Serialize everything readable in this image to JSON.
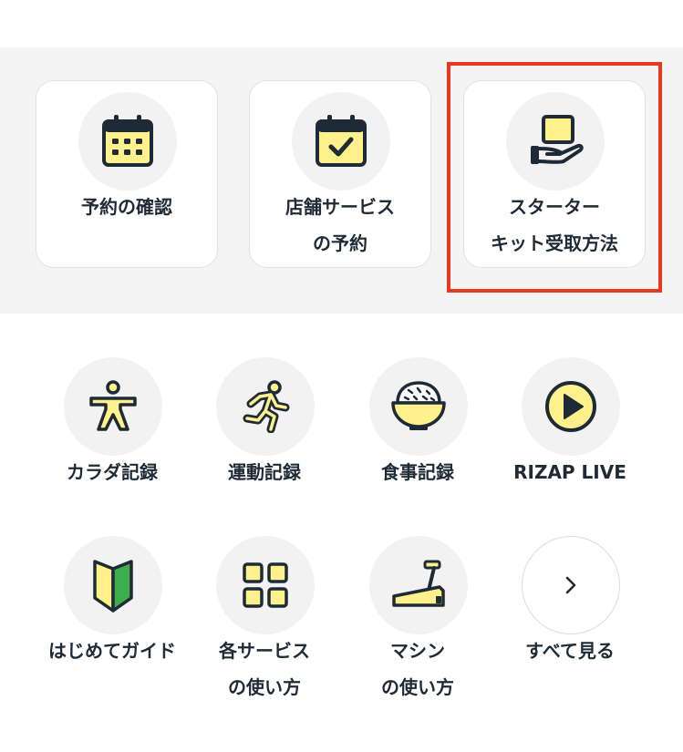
{
  "top_cards": [
    {
      "line1": "予約の確認",
      "line2": "",
      "icon": "calendar-grid-icon"
    },
    {
      "line1": "店舗サービス",
      "line2": "の予約",
      "icon": "calendar-check-icon"
    },
    {
      "line1": "スターター",
      "line2": "キット受取方法",
      "icon": "hand-box-icon"
    }
  ],
  "grid_items": [
    {
      "line1": "カラダ記録",
      "line2": "",
      "icon": "body-icon"
    },
    {
      "line1": "運動記録",
      "line2": "",
      "icon": "running-icon"
    },
    {
      "line1": "食事記録",
      "line2": "",
      "icon": "rice-bowl-icon"
    },
    {
      "line1": "RIZAP LIVE",
      "line2": "",
      "icon": "play-icon"
    },
    {
      "line1": "はじめてガイド",
      "line2": "",
      "icon": "beginner-mark-icon"
    },
    {
      "line1": "各サービス",
      "line2": "の使い方",
      "icon": "grid-icon"
    },
    {
      "line1": "マシン",
      "line2": "の使い方",
      "icon": "treadmill-icon"
    },
    {
      "line1": "すべて見る",
      "line2": "",
      "icon": "chevron-right-icon"
    }
  ],
  "colors": {
    "accent_yellow": "#fef08a",
    "icon_stroke": "#1e2a36",
    "highlight_red": "#e8381d",
    "band_gray": "#f4f4f4",
    "circle_gray": "#f2f2f2",
    "beginner_green": "#3dae4e"
  }
}
